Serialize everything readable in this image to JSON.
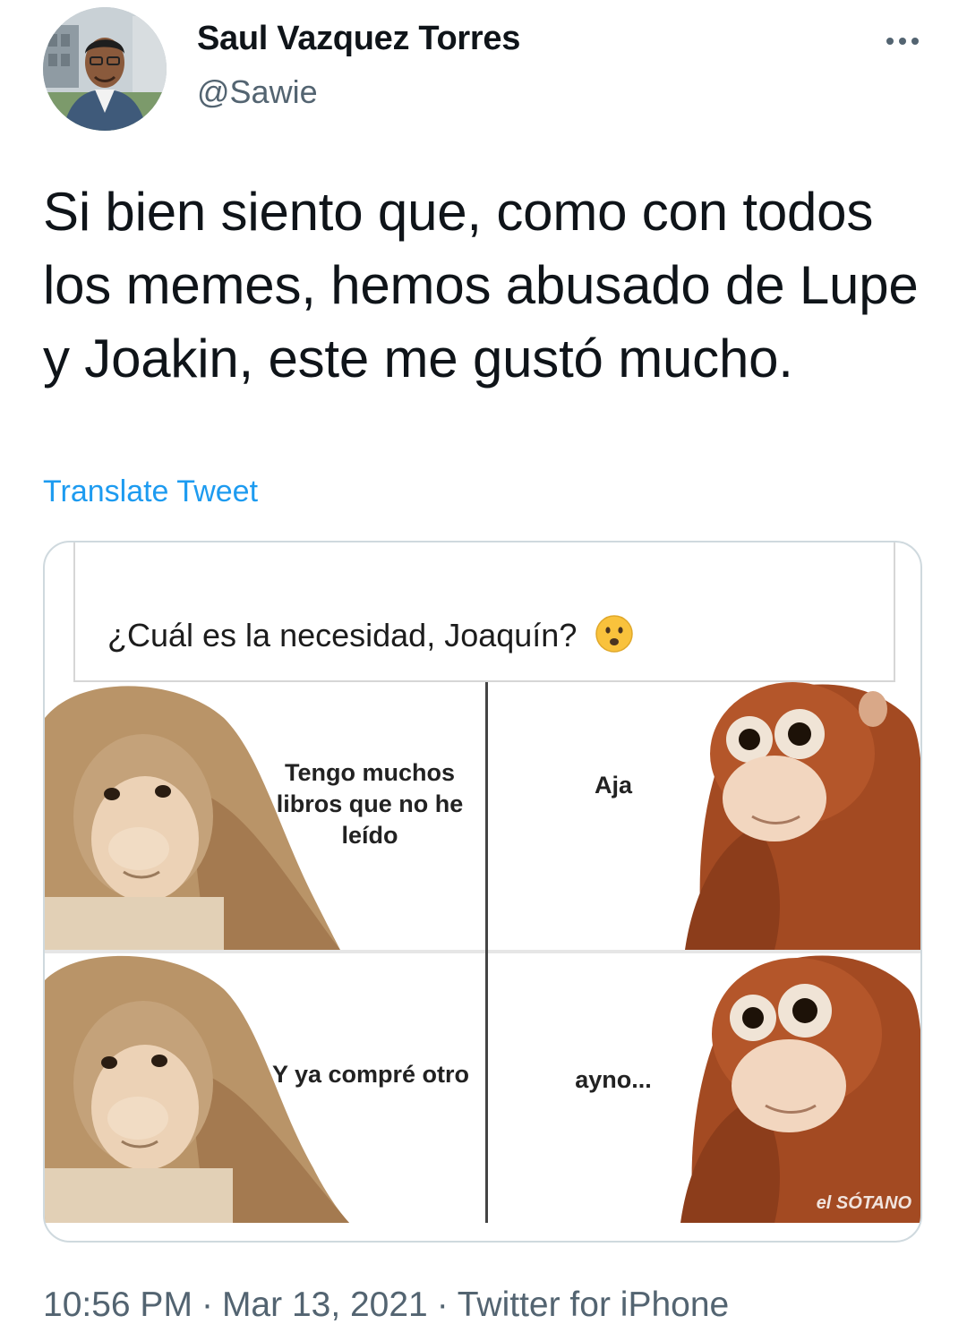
{
  "author": {
    "display_name": "Saul Vazquez Torres",
    "handle": "@Sawie"
  },
  "tweet": {
    "text": "Si bien siento que, como con todos los memes, hemos abusado de Lupe y Joakin, este me gustó mucho.",
    "translate_label": "Translate Tweet"
  },
  "media": {
    "caption": "¿Cuál es la necesidad, Joaquín?",
    "caption_emoji": "worried-face",
    "panels": [
      {
        "label": "Tengo muchos libros que no he leído"
      },
      {
        "label": "Aja"
      },
      {
        "label": "Y ya compré otro"
      },
      {
        "label": "ayno..."
      }
    ],
    "watermark": "el SÓTANO"
  },
  "footer": {
    "time": "10:56 PM",
    "date": "Mar 13, 2021",
    "source": "Twitter for iPhone"
  },
  "colors": {
    "primary_text": "#0f1419",
    "secondary_text": "#536471",
    "link": "#1d9bf0",
    "border": "#cfd9de"
  }
}
